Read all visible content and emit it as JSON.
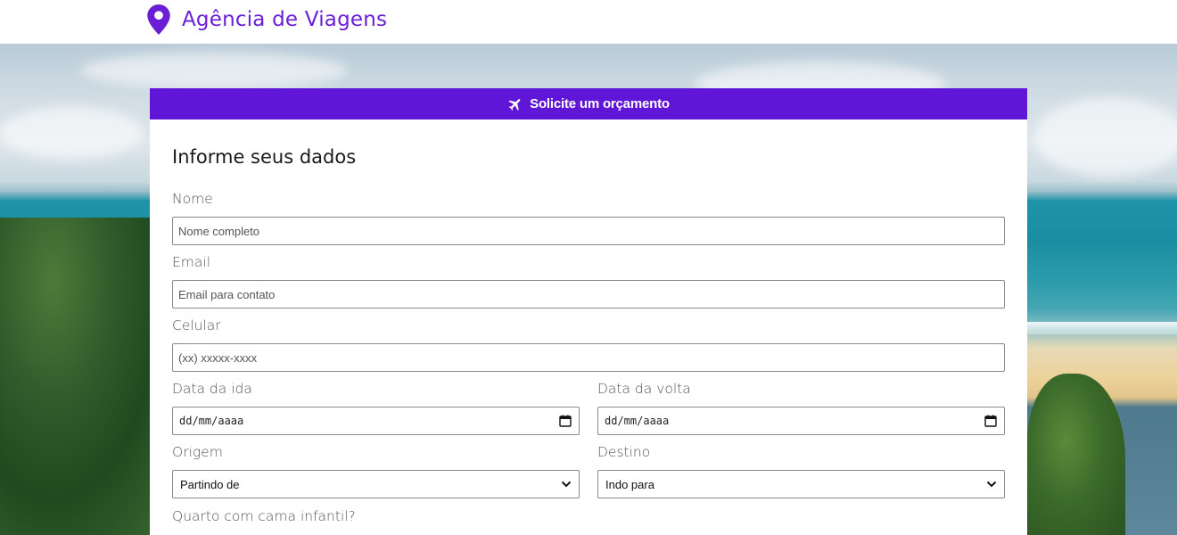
{
  "brand": {
    "name": "Agência de Viagens",
    "icon": "map-pin-icon",
    "color": "#6a1fd6"
  },
  "form": {
    "header": {
      "icon": "airplane-icon",
      "label": "Solicite um orçamento",
      "color": "#6016d6"
    },
    "section_title": "Informe seus dados",
    "fields": {
      "nome": {
        "label": "Nome",
        "placeholder": "Nome completo"
      },
      "email": {
        "label": "Email",
        "placeholder": "Email para contato"
      },
      "celular": {
        "label": "Celular",
        "placeholder": "(xx) xxxxx-xxxx"
      },
      "data_ida": {
        "label": "Data da ida",
        "value": "dd/mm/aaaa",
        "icon": "calendar-icon"
      },
      "data_volta": {
        "label": "Data da volta",
        "value": "dd/mm/aaaa",
        "icon": "calendar-icon"
      },
      "origem": {
        "label": "Origem",
        "selected": "Partindo de",
        "icon": "chevron-down-icon"
      },
      "destino": {
        "label": "Destino",
        "selected": "Indo para",
        "icon": "chevron-down-icon"
      },
      "quarto": {
        "label": "Quarto com cama infantil?"
      }
    }
  }
}
